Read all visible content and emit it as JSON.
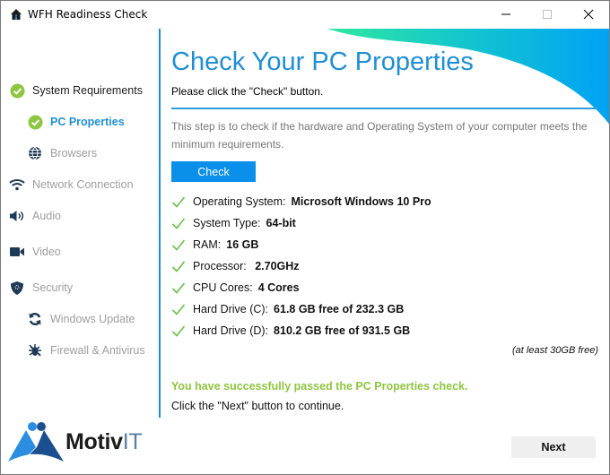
{
  "window": {
    "title": "WFH Readiness Check",
    "app_icon": "house-icon",
    "controls": [
      "minimize",
      "maximize",
      "close"
    ]
  },
  "sidebar": {
    "items": [
      {
        "label": "System Requirements",
        "icon": "check-circle-icon",
        "state": "done",
        "level": 0
      },
      {
        "label": "PC Properties",
        "icon": "check-circle-icon",
        "state": "active",
        "level": 1
      },
      {
        "label": "Browsers",
        "icon": "globe-icon",
        "state": "pending",
        "level": 1
      },
      {
        "label": "Network Connection",
        "icon": "wifi-icon",
        "state": "pending",
        "level": 0
      },
      {
        "label": "Audio",
        "icon": "speaker-icon",
        "state": "pending",
        "level": 0
      },
      {
        "label": "Video",
        "icon": "video-camera-icon",
        "state": "pending",
        "level": 0
      },
      {
        "label": "Security",
        "icon": "shield-icon",
        "state": "pending",
        "level": 0
      },
      {
        "label": "Windows Update",
        "icon": "refresh-icon",
        "state": "pending",
        "level": 1
      },
      {
        "label": "Firewall & Antivirus",
        "icon": "bug-icon",
        "state": "pending",
        "level": 1
      }
    ]
  },
  "main": {
    "title": "Check Your PC Properties",
    "instruction": "Please click the \"Check\" button.",
    "description": "This step is to check if the hardware and Operating System of your computer meets the minimum requirements.",
    "check_button": "Check",
    "results": [
      {
        "label": "Operating System:",
        "value": "Microsoft Windows 10 Pro",
        "status": "pass"
      },
      {
        "label": "System Type:",
        "value": "64-bit",
        "status": "pass"
      },
      {
        "label": "RAM:",
        "value": "16 GB",
        "status": "pass"
      },
      {
        "label": "Processor:",
        "value": " 2.70GHz",
        "status": "pass"
      },
      {
        "label": "CPU Cores:",
        "value": "4 Cores",
        "status": "pass"
      },
      {
        "label": "Hard Drive (C):",
        "value": "61.8 GB free of 232.3 GB",
        "status": "pass"
      },
      {
        "label": "Hard Drive (D):",
        "value": "810.2 GB free of 931.5 GB",
        "status": "pass"
      }
    ],
    "disk_note": "(at least 30GB free)",
    "success_message": "You have successfully passed the PC Properties check.",
    "continue_message": "Click the \"Next\" button to continue."
  },
  "footer": {
    "brand_main": "Motiv",
    "brand_suffix": "IT",
    "next_button": "Next"
  },
  "colors": {
    "accent": "#1e8fd6",
    "button": "#0a8fea",
    "success": "#8dc63f",
    "check_tick": "#6cc04a",
    "icon_dark": "#1f3a57",
    "pending_text": "#9e9e9e"
  }
}
